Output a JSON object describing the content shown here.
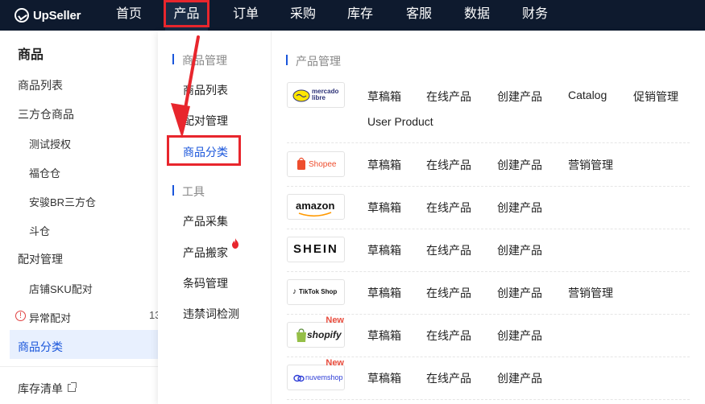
{
  "app": {
    "logo_text": "UpSeller"
  },
  "topnav": {
    "items": [
      {
        "label": "首页"
      },
      {
        "label": "产品"
      },
      {
        "label": "订单"
      },
      {
        "label": "采购"
      },
      {
        "label": "库存"
      },
      {
        "label": "客服"
      },
      {
        "label": "数据"
      },
      {
        "label": "财务"
      }
    ],
    "active": "产品"
  },
  "sidebar": {
    "title": "商品",
    "items": [
      {
        "label": "商品列表"
      },
      {
        "label": "三方仓商品"
      },
      {
        "label": "测试授权"
      },
      {
        "label": "福仓仓"
      },
      {
        "label": "安骏BR三方仓"
      },
      {
        "label": "斗仓"
      },
      {
        "label": "配对管理"
      },
      {
        "label": "店铺SKU配对"
      },
      {
        "label": "异常配对"
      },
      {
        "label": "商品分类"
      },
      {
        "label": "库存清单"
      }
    ],
    "count_partial": "13"
  },
  "dropdown": {
    "left": {
      "section1": "商品管理",
      "items1": [
        {
          "label": "商品列表"
        },
        {
          "label": "配对管理"
        },
        {
          "label": "商品分类"
        }
      ],
      "section2": "工具",
      "items2": [
        {
          "label": "产品采集"
        },
        {
          "label": "产品搬家"
        },
        {
          "label": "条码管理"
        },
        {
          "label": "违禁词检测"
        }
      ]
    },
    "right": {
      "section": "产品管理",
      "rows": [
        {
          "platform": "mercado libre",
          "links": [
            "草稿箱",
            "在线产品",
            "创建产品",
            "Catalog",
            "促销管理",
            "User Product"
          ]
        },
        {
          "platform": "Shopee",
          "links": [
            "草稿箱",
            "在线产品",
            "创建产品",
            "营销管理"
          ]
        },
        {
          "platform": "amazon",
          "links": [
            "草稿箱",
            "在线产品",
            "创建产品"
          ]
        },
        {
          "platform": "SHEIN",
          "links": [
            "草稿箱",
            "在线产品",
            "创建产品"
          ]
        },
        {
          "platform": "TikTok Shop",
          "links": [
            "草稿箱",
            "在线产品",
            "创建产品",
            "营销管理"
          ]
        },
        {
          "platform": "shopify",
          "new": "New",
          "links": [
            "草稿箱",
            "在线产品",
            "创建产品"
          ]
        },
        {
          "platform": "nuvemshop",
          "new": "New",
          "links": [
            "草稿箱",
            "在线产品",
            "创建产品"
          ]
        }
      ]
    }
  },
  "colors": {
    "nav_bg": "#0e1a2e",
    "accent": "#1a56db",
    "highlight_red": "#e8262d"
  }
}
